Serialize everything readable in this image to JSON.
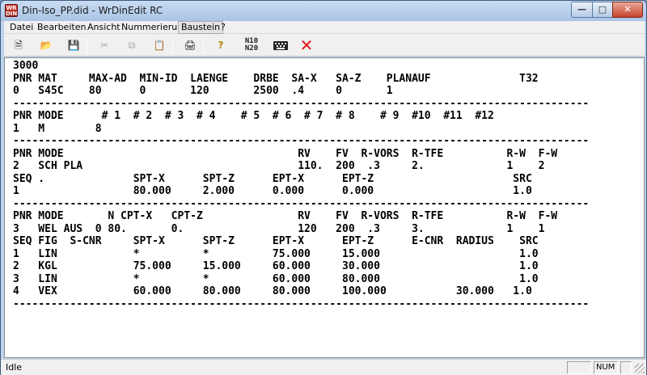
{
  "window": {
    "title": "Din-Iso_PP.did - WrDinEdit RC",
    "icon_text": "WR DIN"
  },
  "menu": [
    "Datei",
    "Bearbeiten",
    "Ansicht",
    "Nummerierung",
    "Baustein",
    "?"
  ],
  "menu_active": "Baustein",
  "toolbar": {
    "icons": [
      "new-icon",
      "open-icon",
      "save-icon",
      "cut-icon",
      "copy-icon",
      "paste-icon",
      "print-icon",
      "help-icon",
      "n10-n20-icon",
      "keyboard-icon",
      "delete-icon"
    ],
    "n10": "N10",
    "n20": "N20",
    "delete_color": "#e3151a"
  },
  "editor": {
    "lines": [
      "3000",
      "PNR MAT     MAX-AD  MIN-ID  LAENGE    DRBE  SA-X   SA-Z    PLANAUF              T32",
      "0   S45C    80      0       120       2500  .4     0       1",
      "-------------------------------------------------------------------------------------------",
      "PNR MODE      # 1  # 2  # 3  # 4    # 5  # 6  # 7  # 8    # 9  #10  #11  #12",
      "1   M        8",
      "-------------------------------------------------------------------------------------------",
      "PNR MODE                                     RV    FV  R-VORS  R-TFE          R-W  F-W",
      "2   SCH PLA                                  110.  200  .3     2.             1    2",
      "SEQ .              SPT-X      SPT-Z      EPT-X      EPT-Z                      SRC",
      "1                  80.000     2.000      0.000      0.000                      1.0",
      "-------------------------------------------------------------------------------------------",
      "PNR MODE       N CPT-X   CPT-Z               RV    FV  R-VORS  R-TFE          R-W  F-W",
      "3   WEL AUS  0 80.       0.                  120   200  .3     3.             1    1",
      "SEQ FIG  S-CNR     SPT-X      SPT-Z      EPT-X      EPT-Z      E-CNR  RADIUS    SRC",
      "1   LIN            *          *          75.000     15.000                      1.0",
      "2   KGL            75.000     15.000     60.000     30.000                      1.0",
      "3   LIN            *          *          60.000     80.000                      1.0",
      "4   VEX            60.000     80.000     80.000     100.000           30.000   1.0",
      "-------------------------------------------------------------------------------------------"
    ]
  },
  "status": {
    "text": "Idle",
    "num": "NUM"
  }
}
